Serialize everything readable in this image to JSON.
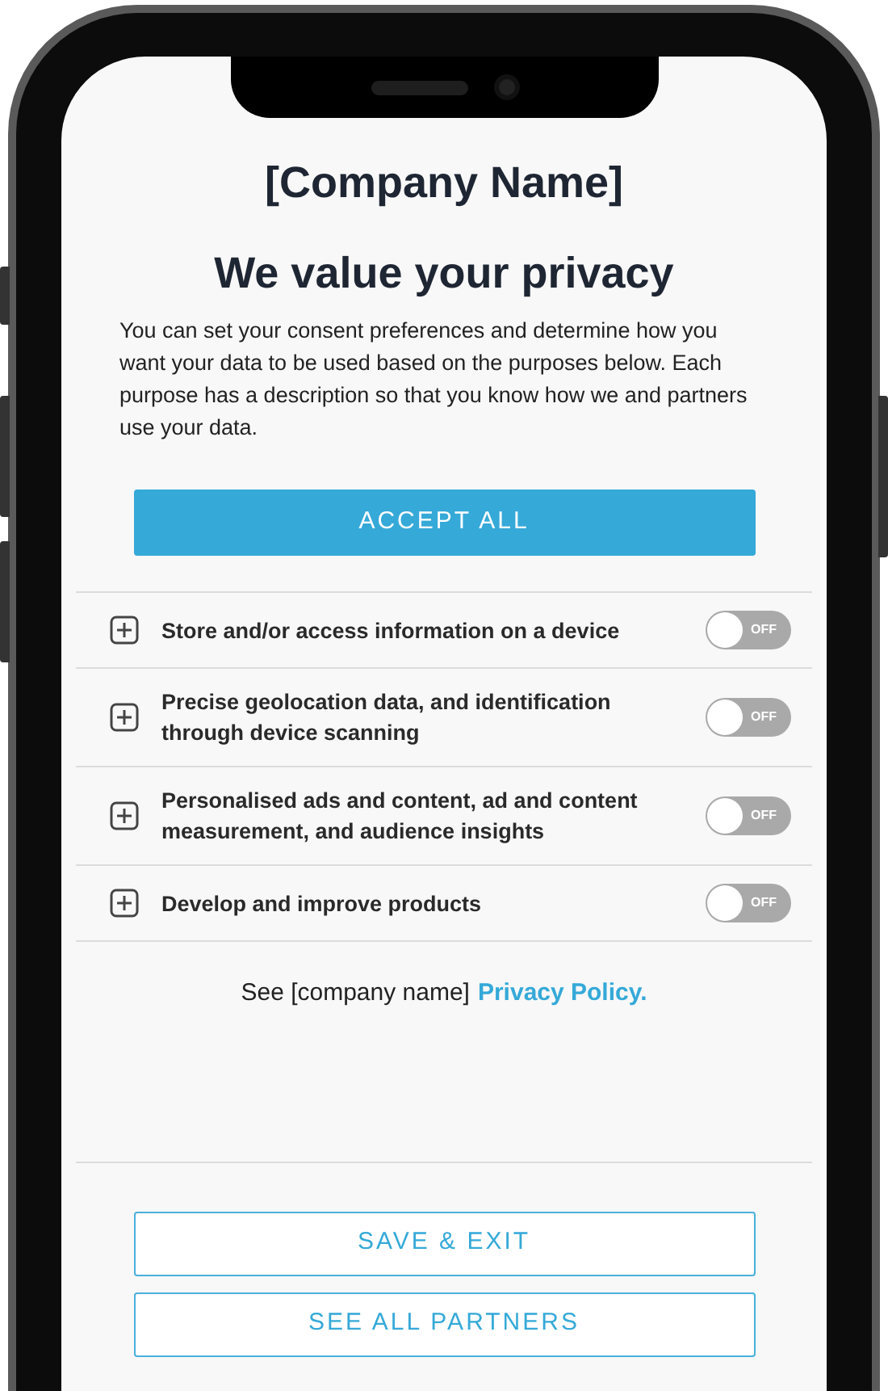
{
  "company_name": "[Company Name]",
  "heading": "We value your privacy",
  "intro": "You can set your consent preferences and determine how you want your data to be used based on the purposes below. Each purpose has a description so that you know how we and partners use your data.",
  "accept_button": "ACCEPT ALL",
  "purposes": [
    {
      "label": "Store and/or access information on a device",
      "on": false,
      "toggle_text": "OFF"
    },
    {
      "label": "Precise geolocation data, and identification through device scanning",
      "on": false,
      "toggle_text": "OFF"
    },
    {
      "label": "Personalised ads and content, ad and content measurement, and audience insights",
      "on": false,
      "toggle_text": "OFF"
    },
    {
      "label": "Develop and improve products",
      "on": false,
      "toggle_text": "OFF"
    }
  ],
  "policy_text": "See [company name]",
  "policy_link": "Privacy Policy.",
  "buttons": [
    "SAVE & EXIT",
    "SEE ALL PARTNERS"
  ]
}
